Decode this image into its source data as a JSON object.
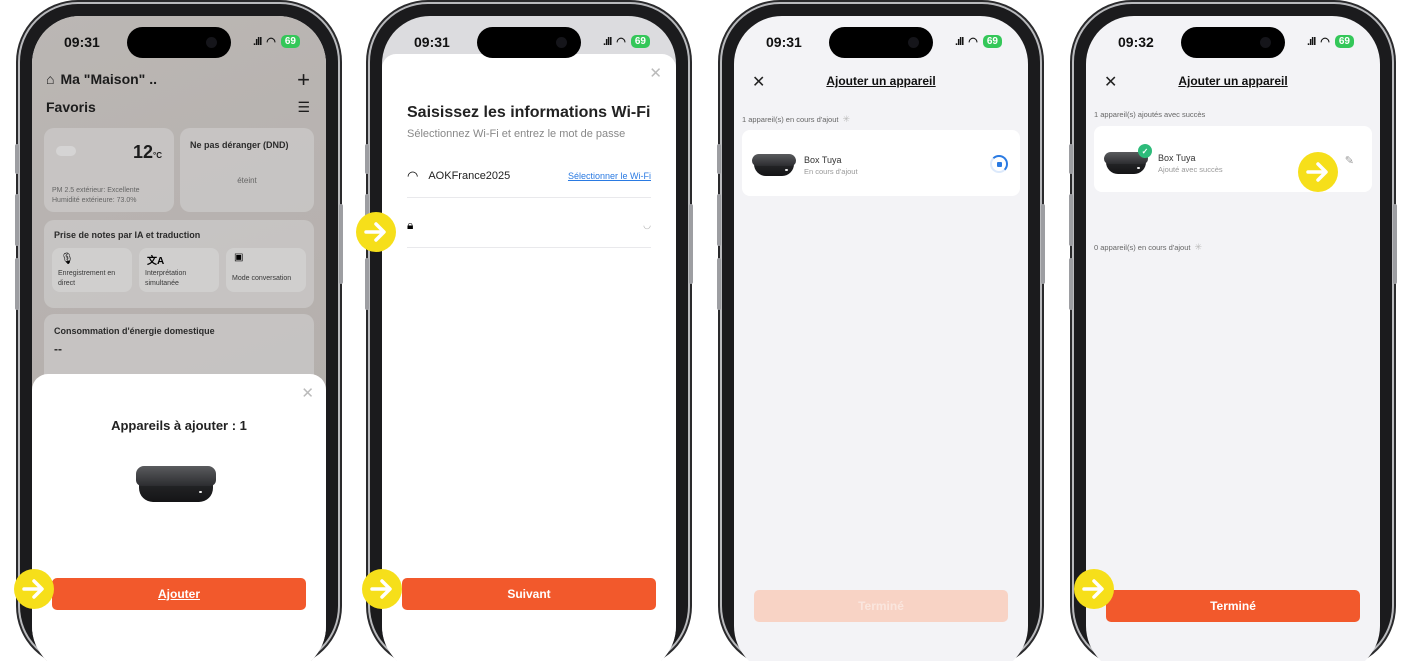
{
  "colors": {
    "accent": "#f2592c",
    "link": "#2a7ae2",
    "highlight_arrow": "#f6df1a",
    "success": "#2dbb7a",
    "battery": "#34c759"
  },
  "screen1": {
    "time": "09:31",
    "battery": "69",
    "home_title": "Ma \"Maison\" ..",
    "favorites_label": "Favoris",
    "weather": {
      "temp": "12",
      "unit": "°C",
      "pm25": "PM 2.5 extérieur: Excellente",
      "humidity": "Humidité extérieure: 73.0%"
    },
    "dnd": {
      "title": "Ne pas déranger (DND)",
      "state": "éteint"
    },
    "notes": {
      "title": "Prise de notes par IA et traduction",
      "items": [
        {
          "label": "Enregistrement en direct",
          "icon": "microphone-icon"
        },
        {
          "label": "Interprétation simultanée",
          "icon": "translate-icon"
        },
        {
          "label": "Mode conversation",
          "icon": "conversation-icon"
        }
      ]
    },
    "energy": {
      "title": "Consommation d'énergie domestique",
      "value": "--"
    },
    "sheet": {
      "title": "Appareils à ajouter : 1",
      "button": "Ajouter"
    }
  },
  "screen2": {
    "time": "09:31",
    "battery": "69",
    "title": "Saisissez les informations Wi-Fi",
    "subtitle": "Sélectionnez Wi-Fi et entrez le mot de passe",
    "wifi_name": "AOKFrance2025",
    "select_wifi": "Sélectionner le Wi-Fi",
    "password_value": "",
    "button": "Suivant"
  },
  "screen3": {
    "time": "09:31",
    "battery": "69",
    "header": "Ajouter un appareil",
    "status": "1 appareil(s) en cours d'ajout",
    "device_name": "Box Tuya",
    "device_state": "En cours d'ajout",
    "button": "Terminé"
  },
  "screen4": {
    "time": "09:32",
    "battery": "69",
    "header": "Ajouter un appareil",
    "success_status": "1 appareil(s) ajoutés avec succès",
    "device_name": "Box Tuya",
    "device_state": "Ajouté avec succès",
    "pending_status": "0 appareil(s) en cours d'ajout",
    "button": "Terminé"
  }
}
